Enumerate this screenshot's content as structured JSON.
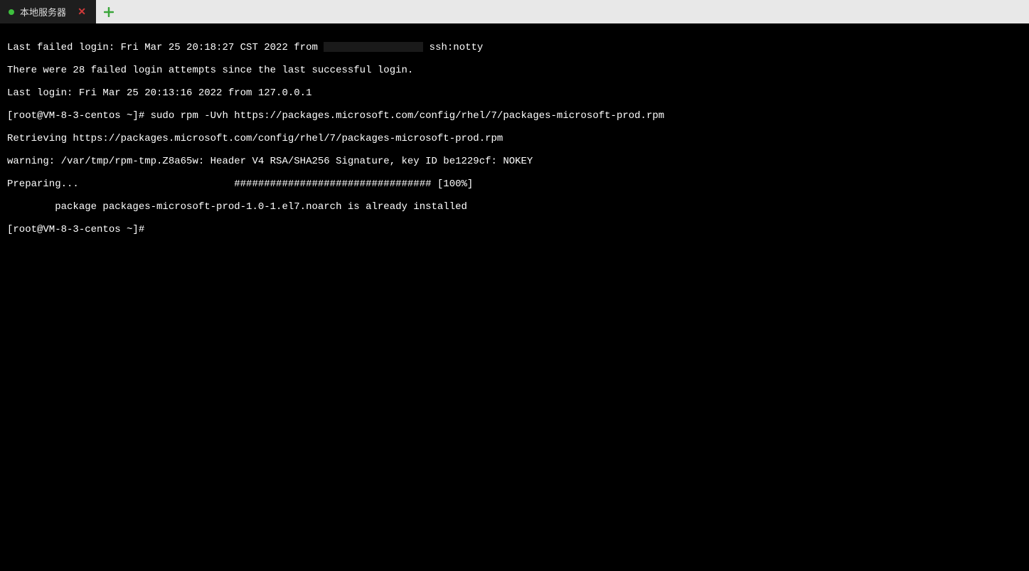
{
  "tabs": {
    "active": {
      "title": "本地服务器",
      "status": "connected"
    }
  },
  "terminal": {
    "line1a": "Last failed login: Fri Mar 25 20:18:27 CST 2022 from ",
    "line1b": " ssh:notty",
    "line2": "There were 28 failed login attempts since the last successful login.",
    "line3": "Last login: Fri Mar 25 20:13:16 2022 from 127.0.0.1",
    "line4": "[root@VM-8-3-centos ~]# sudo rpm -Uvh https://packages.microsoft.com/config/rhel/7/packages-microsoft-prod.rpm",
    "line5": "Retrieving https://packages.microsoft.com/config/rhel/7/packages-microsoft-prod.rpm",
    "line6": "warning: /var/tmp/rpm-tmp.Z8a65w: Header V4 RSA/SHA256 Signature, key ID be1229cf: NOKEY",
    "line7": "Preparing...                          ################################# [100%]",
    "line8": "        package packages-microsoft-prod-1.0-1.el7.noarch is already installed",
    "line9": "[root@VM-8-3-centos ~]# "
  },
  "icons": {
    "close": "✕",
    "add": "+"
  }
}
